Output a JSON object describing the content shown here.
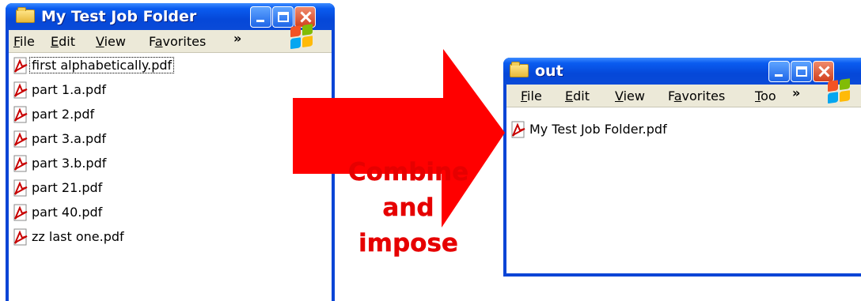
{
  "left_window": {
    "title": "My Test Job Folder",
    "menu": [
      {
        "pre": "",
        "key": "F",
        "post": "ile"
      },
      {
        "pre": "",
        "key": "E",
        "post": "dit"
      },
      {
        "pre": "",
        "key": "V",
        "post": "iew"
      },
      {
        "pre": "F",
        "key": "a",
        "post": "vorites"
      }
    ],
    "chevron": "»",
    "files": [
      "first alphabetically.pdf",
      "part 1.a.pdf",
      "part 2.pdf",
      "part 3.a.pdf",
      "part 3.b.pdf",
      "part 21.pdf",
      "part 40.pdf",
      "zz last one.pdf"
    ]
  },
  "right_window": {
    "title": "out",
    "menu": [
      {
        "pre": "",
        "key": "F",
        "post": "ile"
      },
      {
        "pre": "",
        "key": "E",
        "post": "dit"
      },
      {
        "pre": "",
        "key": "V",
        "post": "iew"
      },
      {
        "pre": "F",
        "key": "a",
        "post": "vorites"
      },
      {
        "pre": "",
        "key": "T",
        "post": "oo"
      }
    ],
    "chevron": "»",
    "files": [
      "My Test Job Folder.pdf"
    ]
  },
  "annotation": {
    "line1": "Combine",
    "line2": "and",
    "line3": "impose",
    "color": "#e60000"
  },
  "icons": {
    "folder": "folder-icon",
    "pdf": "pdf-file-icon",
    "windows_logo": "windows-logo-icon",
    "minimize": "minimize-icon",
    "maximize": "maximize-icon",
    "close": "close-icon"
  }
}
